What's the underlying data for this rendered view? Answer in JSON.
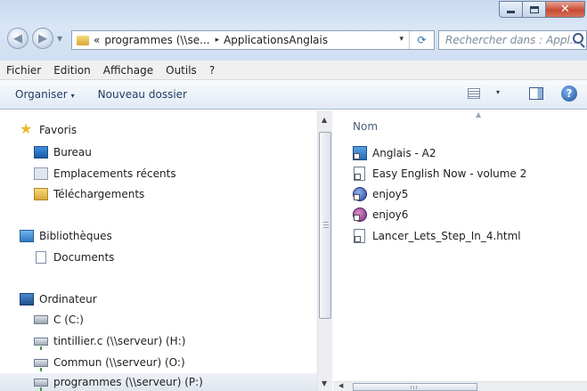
{
  "window": {
    "title_buttons": {
      "minimize": "minimize-icon",
      "maximize": "maximize-icon",
      "close": "close-icon"
    },
    "accent_color": "#c74b33"
  },
  "address_bar": {
    "segments": [
      "«",
      "programmes (\\\\se...",
      "ApplicationsAnglais"
    ],
    "separator_glyph": "▸",
    "dropdown_glyph": "▾",
    "refresh_glyph": "⟳"
  },
  "search": {
    "placeholder": "Rechercher dans : Appl..."
  },
  "menu": {
    "items": [
      "Fichier",
      "Edition",
      "Affichage",
      "Outils",
      "?"
    ]
  },
  "toolbar": {
    "organize_label": "Organiser",
    "new_folder_label": "Nouveau dossier",
    "caret": "▾",
    "help_label": "?"
  },
  "navigation": {
    "favorites": {
      "label": "Favoris",
      "items": [
        "Bureau",
        "Emplacements récents",
        "Téléchargements"
      ]
    },
    "libraries": {
      "label": "Bibliothèques",
      "items": [
        "Documents"
      ]
    },
    "computer": {
      "label": "Ordinateur",
      "items": [
        "C (C:)",
        "tintillier.c (\\\\serveur) (H:)",
        "Commun (\\\\serveur) (O:)",
        "programmes (\\\\serveur) (P:)"
      ],
      "selected": "programmes (\\\\serveur) (P:)"
    }
  },
  "content": {
    "column_header": "Nom",
    "files": [
      {
        "name": "Anglais - A2",
        "icon": "app-shortcut-icon"
      },
      {
        "name": "Easy English Now - volume 2",
        "icon": "html-shortcut-icon"
      },
      {
        "name": "enjoy5",
        "icon": "app-shortcut-icon"
      },
      {
        "name": "enjoy6",
        "icon": "app-shortcut-icon"
      },
      {
        "name": "Lancer_Lets_Step_In_4.html",
        "icon": "html-shortcut-icon"
      }
    ]
  }
}
